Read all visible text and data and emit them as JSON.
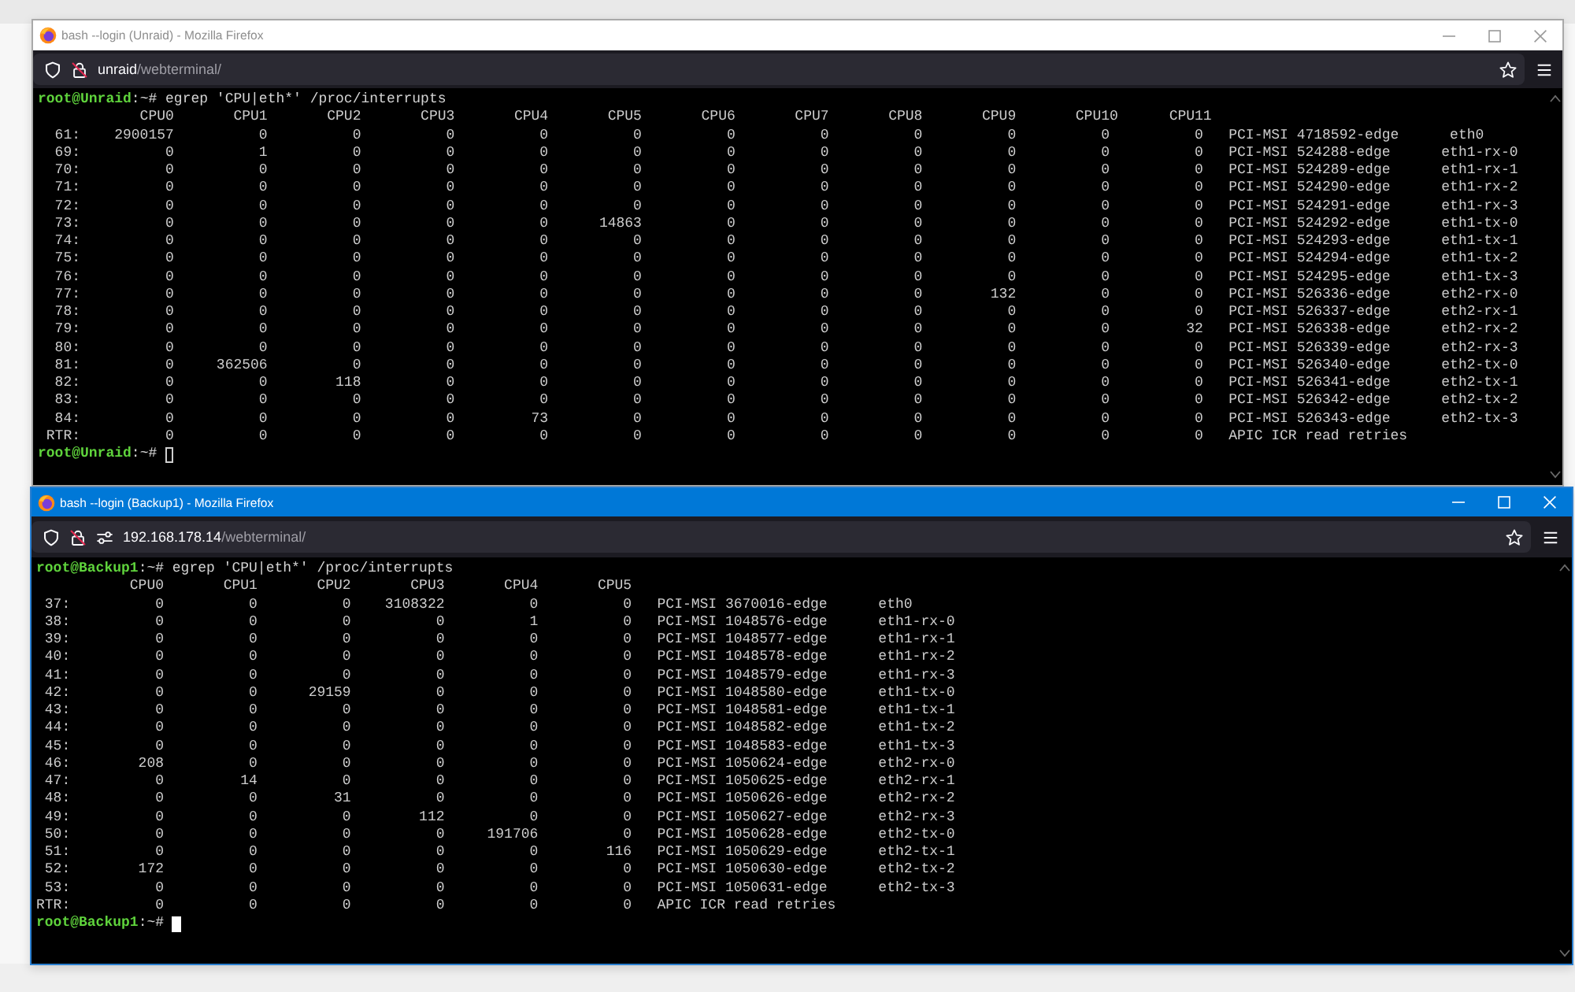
{
  "windows": [
    {
      "title": "bash --login (Unraid) - Mozilla Firefox",
      "active": false,
      "site_permissions": false,
      "address": {
        "host": "unraid",
        "path": "/webterminal/"
      },
      "terminal": {
        "command_line": {
          "prompt_user": "root@Unraid",
          "prompt_suffix": ":~#",
          "command": "egrep 'CPU|eth*' /proc/interrupts"
        },
        "output": [
          "            CPU0       CPU1       CPU2       CPU3       CPU4       CPU5       CPU6       CPU7       CPU8       CPU9       CPU10      CPU11",
          "  61:    2900157          0          0          0          0          0          0          0          0          0          0          0   PCI-MSI 4718592-edge      eth0",
          "  69:          0          1          0          0          0          0          0          0          0          0          0          0   PCI-MSI 524288-edge      eth1-rx-0",
          "  70:          0          0          0          0          0          0          0          0          0          0          0          0   PCI-MSI 524289-edge      eth1-rx-1",
          "  71:          0          0          0          0          0          0          0          0          0          0          0          0   PCI-MSI 524290-edge      eth1-rx-2",
          "  72:          0          0          0          0          0          0          0          0          0          0          0          0   PCI-MSI 524291-edge      eth1-rx-3",
          "  73:          0          0          0          0          0      14863          0          0          0          0          0          0   PCI-MSI 524292-edge      eth1-tx-0",
          "  74:          0          0          0          0          0          0          0          0          0          0          0          0   PCI-MSI 524293-edge      eth1-tx-1",
          "  75:          0          0          0          0          0          0          0          0          0          0          0          0   PCI-MSI 524294-edge      eth1-tx-2",
          "  76:          0          0          0          0          0          0          0          0          0          0          0          0   PCI-MSI 524295-edge      eth1-tx-3",
          "  77:          0          0          0          0          0          0          0          0          0        132          0          0   PCI-MSI 526336-edge      eth2-rx-0",
          "  78:          0          0          0          0          0          0          0          0          0          0          0          0   PCI-MSI 526337-edge      eth2-rx-1",
          "  79:          0          0          0          0          0          0          0          0          0          0          0         32   PCI-MSI 526338-edge      eth2-rx-2",
          "  80:          0          0          0          0          0          0          0          0          0          0          0          0   PCI-MSI 526339-edge      eth2-rx-3",
          "  81:          0     362506          0          0          0          0          0          0          0          0          0          0   PCI-MSI 526340-edge      eth2-tx-0",
          "  82:          0          0        118          0          0          0          0          0          0          0          0          0   PCI-MSI 526341-edge      eth2-tx-1",
          "  83:          0          0          0          0          0          0          0          0          0          0          0          0   PCI-MSI 526342-edge      eth2-tx-2",
          "  84:          0          0          0          0         73          0          0          0          0          0          0          0   PCI-MSI 526343-edge      eth2-tx-3",
          " RTR:          0          0          0          0          0          0          0          0          0          0          0          0   APIC ICR read retries"
        ],
        "prompt": {
          "prompt_user": "root@Unraid",
          "prompt_suffix": ":~#"
        }
      }
    },
    {
      "title": "bash --login (Backup1) - Mozilla Firefox",
      "active": true,
      "site_permissions": true,
      "address": {
        "host": "192.168.178.14",
        "path": "/webterminal/"
      },
      "terminal": {
        "command_line": {
          "prompt_user": "root@Backup1",
          "prompt_suffix": ":~#",
          "command": "egrep 'CPU|eth*' /proc/interrupts"
        },
        "output": [
          "           CPU0       CPU1       CPU2       CPU3       CPU4       CPU5",
          " 37:          0          0          0    3108322          0          0   PCI-MSI 3670016-edge      eth0",
          " 38:          0          0          0          0          1          0   PCI-MSI 1048576-edge      eth1-rx-0",
          " 39:          0          0          0          0          0          0   PCI-MSI 1048577-edge      eth1-rx-1",
          " 40:          0          0          0          0          0          0   PCI-MSI 1048578-edge      eth1-rx-2",
          " 41:          0          0          0          0          0          0   PCI-MSI 1048579-edge      eth1-rx-3",
          " 42:          0          0      29159          0          0          0   PCI-MSI 1048580-edge      eth1-tx-0",
          " 43:          0          0          0          0          0          0   PCI-MSI 1048581-edge      eth1-tx-1",
          " 44:          0          0          0          0          0          0   PCI-MSI 1048582-edge      eth1-tx-2",
          " 45:          0          0          0          0          0          0   PCI-MSI 1048583-edge      eth1-tx-3",
          " 46:        208          0          0          0          0          0   PCI-MSI 1050624-edge      eth2-rx-0",
          " 47:          0         14          0          0          0          0   PCI-MSI 1050625-edge      eth2-rx-1",
          " 48:          0          0         31          0          0          0   PCI-MSI 1050626-edge      eth2-rx-2",
          " 49:          0          0          0        112          0          0   PCI-MSI 1050627-edge      eth2-rx-3",
          " 50:          0          0          0          0     191706          0   PCI-MSI 1050628-edge      eth2-tx-0",
          " 51:          0          0          0          0          0        116   PCI-MSI 1050629-edge      eth2-tx-1",
          " 52:        172          0          0          0          0          0   PCI-MSI 1050630-edge      eth2-tx-2",
          " 53:          0          0          0          0          0          0   PCI-MSI 1050631-edge      eth2-tx-3",
          "RTR:          0          0          0          0          0          0   APIC ICR read retries"
        ],
        "prompt": {
          "prompt_user": "root@Backup1",
          "prompt_suffix": ":~#"
        }
      }
    }
  ]
}
